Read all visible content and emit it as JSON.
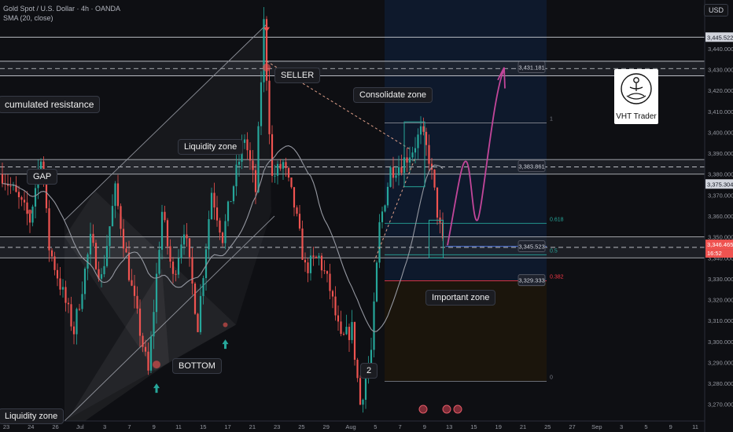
{
  "header": {
    "title": "Gold Spot / U.S. Dollar · 4h · OANDA",
    "indicator": "SMA (20, close)"
  },
  "currency": "USD",
  "brand": {
    "logo_text": "VHT Trader"
  },
  "annotations": {
    "accumulated_resistance": "cumulated resistance",
    "gap": "GAP",
    "liquidity_zone": "Liquidity zone",
    "seller": "SELLER",
    "consolidate_zone": "Consolidate zone",
    "important_zone": "Important zone",
    "bottom": "BOTTOM",
    "wave_2": "2",
    "liquidity_zone_low": "Liquidity zone"
  },
  "colors": {
    "background": "#0e0f13",
    "up": "#26a69a",
    "down": "#ef5350",
    "sma": "#9598a1",
    "projection": "#c2469a",
    "fib": "#26a69a",
    "fib_low": "#f23645"
  },
  "chart_data": {
    "type": "candlestick",
    "title": "Gold Spot / U.S. Dollar · 4h · OANDA",
    "ylim": [
      3262,
      3452
    ],
    "y_ticks": [
      3270,
      3280,
      3290,
      3300,
      3310,
      3320,
      3330,
      3340,
      3350,
      3360,
      3370,
      3380,
      3390,
      3400,
      3410,
      3420,
      3430,
      3440
    ],
    "x_ticks": [
      "23",
      "24",
      "26",
      "Jul",
      "3",
      "7",
      "9",
      "11",
      "15",
      "17",
      "21",
      "23",
      "25",
      "29",
      "Aug",
      "5",
      "7",
      "9",
      "13",
      "15",
      "19",
      "21",
      "25",
      "27",
      "Sep",
      "3",
      "5",
      "9",
      "11"
    ],
    "price_labels": [
      {
        "value": 3445.522,
        "text": "3,445.522",
        "style": "plain"
      },
      {
        "value": 3431.181,
        "text": "3,431.181",
        "style": "level"
      },
      {
        "value": 3383.861,
        "text": "3,383.861",
        "style": "level"
      },
      {
        "value": 3375.304,
        "text": "3,375.304",
        "style": "plain"
      },
      {
        "value": 3345.523,
        "text": "3,345.523",
        "style": "level"
      },
      {
        "value": 3346.465,
        "text": "3,346.465",
        "style": "current"
      },
      {
        "value": 3329.333,
        "text": "3,329.333",
        "style": "level"
      }
    ],
    "countdown": "16:52",
    "fib_levels": [
      {
        "ratio": "1",
        "value": 3404.5
      },
      {
        "ratio": "0.618",
        "value": 3356.5
      },
      {
        "ratio": "0.5",
        "value": 3341.5
      },
      {
        "ratio": "0.382",
        "value": 3329.0
      },
      {
        "ratio": "0",
        "value": 3281.0
      }
    ],
    "sma_period": 20,
    "waypoints": [
      [
        0,
        3380
      ],
      [
        4,
        3372
      ],
      [
        10,
        3358
      ],
      [
        14,
        3390
      ],
      [
        17,
        3345
      ],
      [
        26,
        3305
      ],
      [
        32,
        3348
      ],
      [
        36,
        3330
      ],
      [
        41,
        3372
      ],
      [
        47,
        3325
      ],
      [
        53,
        3285
      ],
      [
        58,
        3362
      ],
      [
        62,
        3330
      ],
      [
        66,
        3355
      ],
      [
        71,
        3308
      ],
      [
        76,
        3372
      ],
      [
        80,
        3350
      ],
      [
        84,
        3375
      ],
      [
        88,
        3398
      ],
      [
        92,
        3372
      ],
      [
        95,
        3452
      ],
      [
        98,
        3378
      ],
      [
        102,
        3385
      ],
      [
        106,
        3365
      ],
      [
        110,
        3335
      ],
      [
        115,
        3340
      ],
      [
        119,
        3325
      ],
      [
        123,
        3300
      ],
      [
        127,
        3306
      ],
      [
        130,
        3270
      ],
      [
        134,
        3295
      ],
      [
        137,
        3355
      ],
      [
        141,
        3382
      ],
      [
        145,
        3385
      ],
      [
        149,
        3392
      ],
      [
        152,
        3400
      ],
      [
        155,
        3388
      ],
      [
        158,
        3362
      ],
      [
        160,
        3346
      ]
    ],
    "bars": 161
  }
}
